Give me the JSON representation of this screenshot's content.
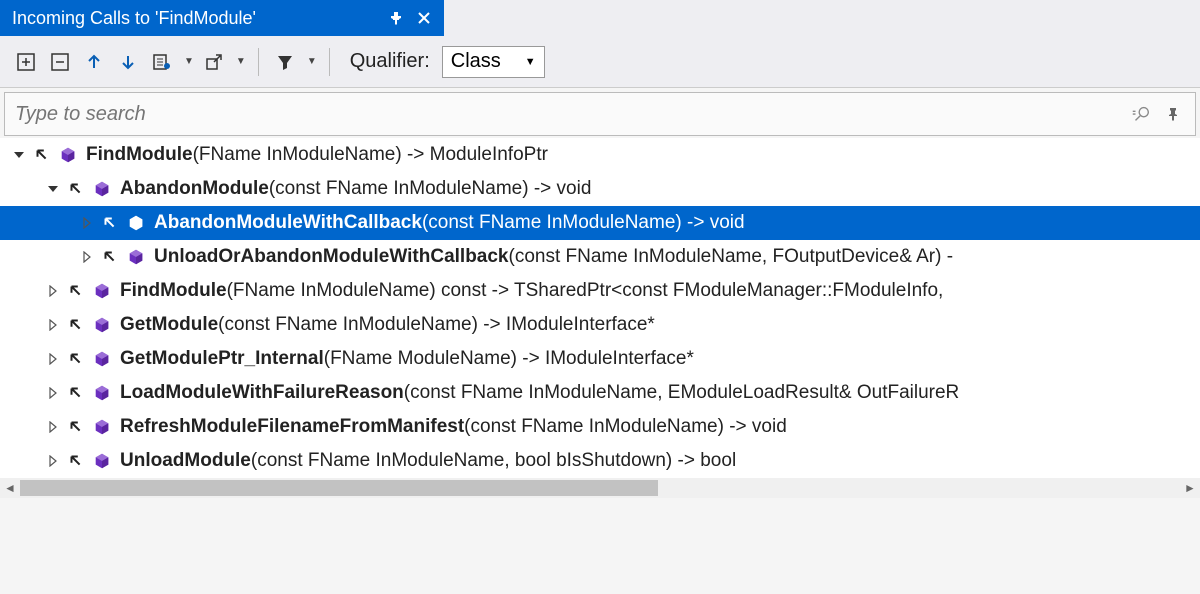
{
  "title": "Incoming Calls to 'FindModule'",
  "toolbar": {
    "qualifier_label": "Qualifier:",
    "qualifier_value": "Class"
  },
  "search": {
    "placeholder": "Type to search"
  },
  "tree": [
    {
      "level": 0,
      "expander": "expanded",
      "selected": false,
      "name": "FindModule",
      "sig": "(FName InModuleName) -> ModuleInfoPtr"
    },
    {
      "level": 1,
      "expander": "expanded",
      "selected": false,
      "name": "AbandonModule",
      "sig": "(const FName InModuleName) -> void"
    },
    {
      "level": 2,
      "expander": "collapsed",
      "selected": true,
      "name": "AbandonModuleWithCallback",
      "sig": "(const FName InModuleName) -> void"
    },
    {
      "level": 2,
      "expander": "collapsed",
      "selected": false,
      "name": "UnloadOrAbandonModuleWithCallback",
      "sig": "(const FName InModuleName, FOutputDevice& Ar) -"
    },
    {
      "level": 1,
      "expander": "collapsed",
      "selected": false,
      "name": "FindModule",
      "sig": "(FName InModuleName) const -> TSharedPtr<const FModuleManager::FModuleInfo,"
    },
    {
      "level": 1,
      "expander": "collapsed",
      "selected": false,
      "name": "GetModule",
      "sig": "(const FName InModuleName) -> IModuleInterface*"
    },
    {
      "level": 1,
      "expander": "collapsed",
      "selected": false,
      "name": "GetModulePtr_Internal",
      "sig": "(FName ModuleName) -> IModuleInterface*"
    },
    {
      "level": 1,
      "expander": "collapsed",
      "selected": false,
      "name": "LoadModuleWithFailureReason",
      "sig": "(const FName InModuleName, EModuleLoadResult& OutFailureR"
    },
    {
      "level": 1,
      "expander": "collapsed",
      "selected": false,
      "name": "RefreshModuleFilenameFromManifest",
      "sig": "(const FName InModuleName) -> void"
    },
    {
      "level": 1,
      "expander": "collapsed",
      "selected": false,
      "name": "UnloadModule",
      "sig": "(const FName InModuleName, bool bIsShutdown) -> bool"
    }
  ]
}
